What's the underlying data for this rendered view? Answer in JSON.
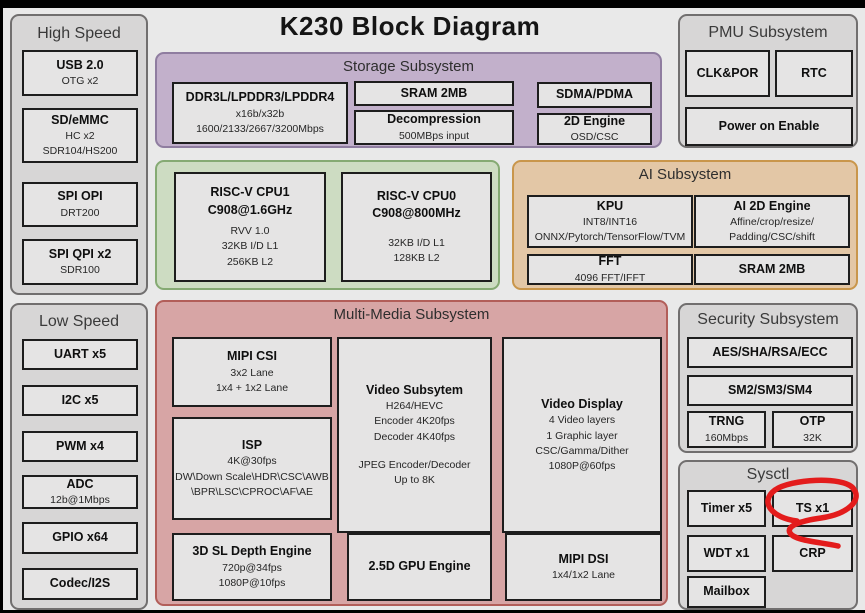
{
  "title": "K230 Block Diagram",
  "high_speed": {
    "title": "High Speed",
    "blocks": [
      {
        "name": "USB 2.0",
        "sub": [
          "OTG x2"
        ]
      },
      {
        "name": "SD/eMMC",
        "sub": [
          "HC x2",
          "SDR104/HS200"
        ]
      },
      {
        "name": "SPI OPI",
        "sub": [
          "DRT200"
        ]
      },
      {
        "name": "SPI QPI x2",
        "sub": [
          "SDR100"
        ]
      }
    ]
  },
  "storage": {
    "title": "Storage Subsystem",
    "blocks": [
      {
        "name": "DDR3L/LPDDR3/LPDDR4",
        "sub": [
          "x16b/x32b",
          "1600/2133/2667/3200Mbps"
        ]
      },
      {
        "name": "SRAM 2MB",
        "sub": []
      },
      {
        "name": "Decompression",
        "sub": [
          "500MBps input"
        ]
      },
      {
        "name": "SDMA/PDMA",
        "sub": []
      },
      {
        "name": "2D Engine",
        "sub": [
          "OSD/CSC"
        ]
      }
    ]
  },
  "pmu": {
    "title": "PMU Subsystem",
    "blocks": [
      {
        "name": "CLK&POR"
      },
      {
        "name": "RTC"
      },
      {
        "name": "Power on Enable"
      }
    ]
  },
  "cpu": {
    "blocks": [
      {
        "name": "RISC-V CPU1",
        "name2": "C908@1.6GHz",
        "sub": [
          "RVV 1.0",
          "32KB I/D L1",
          "256KB L2"
        ]
      },
      {
        "name": "RISC-V CPU0",
        "name2": "C908@800MHz",
        "sub": [
          "32KB I/D L1",
          "128KB L2"
        ]
      }
    ]
  },
  "ai": {
    "title": "AI Subsystem",
    "blocks": [
      {
        "name": "KPU",
        "sub": [
          "INT8/INT16",
          "ONNX/Pytorch/TensorFlow/TVM"
        ]
      },
      {
        "name": "AI 2D Engine",
        "sub": [
          "Affine/crop/resize/",
          "Padding/CSC/shift"
        ]
      },
      {
        "name": "FFT",
        "sub": [
          "4096 FFT/IFFT"
        ]
      },
      {
        "name": "SRAM 2MB",
        "sub": []
      }
    ]
  },
  "low_speed": {
    "title": "Low Speed",
    "blocks": [
      {
        "name": "UART x5",
        "sub": []
      },
      {
        "name": "I2C x5",
        "sub": []
      },
      {
        "name": "PWM x4",
        "sub": []
      },
      {
        "name": "ADC",
        "sub": [
          "12b@1Mbps"
        ]
      },
      {
        "name": "GPIO x64",
        "sub": []
      },
      {
        "name": "Codec/I2S",
        "sub": []
      }
    ]
  },
  "multimedia": {
    "title": "Multi-Media Subsystem",
    "blocks": [
      {
        "name": "MIPI CSI",
        "sub": [
          "3x2 Lane",
          "1x4 + 1x2 Lane"
        ]
      },
      {
        "name": "ISP",
        "sub": [
          "4K@30fps",
          "DW\\Down Scale\\HDR\\CSC\\AWB",
          "\\BPR\\LSC\\CPROC\\AF\\AE"
        ]
      },
      {
        "name": "Video Subsytem",
        "sub": [
          "H264/HEVC",
          "Encoder 4K20fps",
          "Decoder 4K40fps",
          "JPEG Encoder/Decoder",
          "Up to 8K"
        ]
      },
      {
        "name": "Video Display",
        "sub": [
          "4 Video layers",
          "1 Graphic layer",
          "CSC/Gamma/Dither",
          "1080P@60fps"
        ]
      },
      {
        "name": "3D SL Depth Engine",
        "sub": [
          "720p@34fps",
          "1080P@10fps"
        ]
      },
      {
        "name": "2.5D GPU Engine",
        "sub": []
      },
      {
        "name": "MIPI DSI",
        "sub": [
          "1x4/1x2 Lane"
        ]
      }
    ]
  },
  "security": {
    "title": "Security Subsystem",
    "blocks": [
      {
        "name": "AES/SHA/RSA/ECC",
        "sub": []
      },
      {
        "name": "SM2/SM3/SM4",
        "sub": []
      },
      {
        "name": "TRNG",
        "sub": [
          "160Mbps"
        ]
      },
      {
        "name": "OTP",
        "sub": [
          "32K"
        ]
      }
    ]
  },
  "sysctl": {
    "title": "Sysctl",
    "blocks": [
      {
        "name": "Timer x5"
      },
      {
        "name": "TS x1"
      },
      {
        "name": "WDT x1"
      },
      {
        "name": "CRP"
      },
      {
        "name": "Mailbox"
      }
    ]
  },
  "annotation": {
    "target": "TS x1",
    "shape": "hand-drawn circle with tail"
  },
  "colors": {
    "storage": {
      "bg": "#c2b0cb",
      "border": "#8f7da0"
    },
    "cpu": {
      "bg": "#cddcc2",
      "border": "#85aa73"
    },
    "ai": {
      "bg": "#e3c7a6",
      "border": "#c9964b"
    },
    "multimedia": {
      "bg": "#d7a5a5",
      "border": "#b25e59"
    },
    "annotation": "#e31c1c"
  }
}
